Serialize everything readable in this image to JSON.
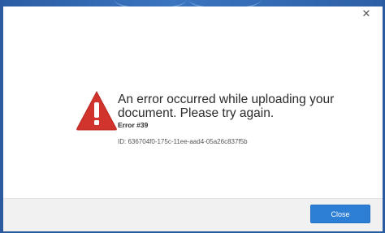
{
  "dialog": {
    "title_text": "An error occurred while uploading your document. Please try again.",
    "error_code": "Error #39",
    "error_id": "ID: 636704f0-175c-11ee-aad4-05a26c837f5b",
    "close_icon": "close-icon",
    "warning_icon": "warning-triangle-icon",
    "close_button_label": "Close"
  },
  "colors": {
    "accent": "#2d7fd6",
    "warning": "#d0342c",
    "backdrop": "#2f63a8"
  }
}
